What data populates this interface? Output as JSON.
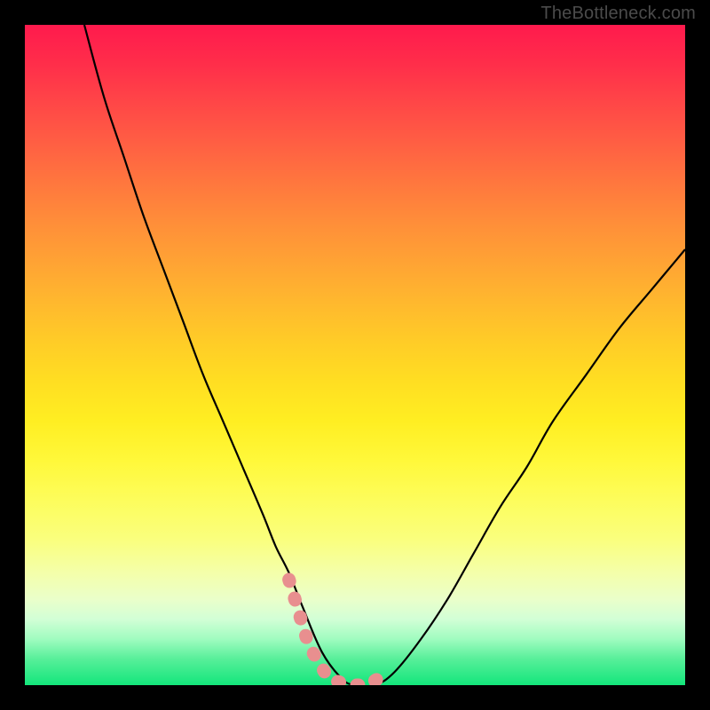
{
  "watermark": "TheBottleneck.com",
  "colors": {
    "frame": "#000000",
    "curve": "#000000",
    "marker": "#e88f8f"
  },
  "chart_data": {
    "type": "line",
    "title": "",
    "xlabel": "",
    "ylabel": "",
    "xlim": [
      0,
      100
    ],
    "ylim": [
      0,
      100
    ],
    "grid": false,
    "legend": false,
    "series": [
      {
        "name": "curve",
        "x": [
          9,
          12,
          15,
          18,
          21,
          24,
          27,
          30,
          33,
          36,
          38,
          40,
          42,
          45,
          48,
          50,
          53,
          56,
          60,
          64,
          68,
          72,
          76,
          80,
          85,
          90,
          95,
          100
        ],
        "y": [
          100,
          89,
          80,
          71,
          63,
          55,
          47,
          40,
          33,
          26,
          21,
          17,
          12,
          5,
          1,
          0,
          0,
          2,
          7,
          13,
          20,
          27,
          33,
          40,
          47,
          54,
          60,
          66
        ]
      }
    ],
    "annotations": [
      {
        "name": "dotted-highlight",
        "type": "polyline",
        "style": "thick-dotted",
        "points_x": [
          40,
          43,
          46,
          49,
          52,
          55
        ],
        "points_y": [
          16,
          6,
          1,
          0,
          0,
          2
        ]
      }
    ]
  }
}
